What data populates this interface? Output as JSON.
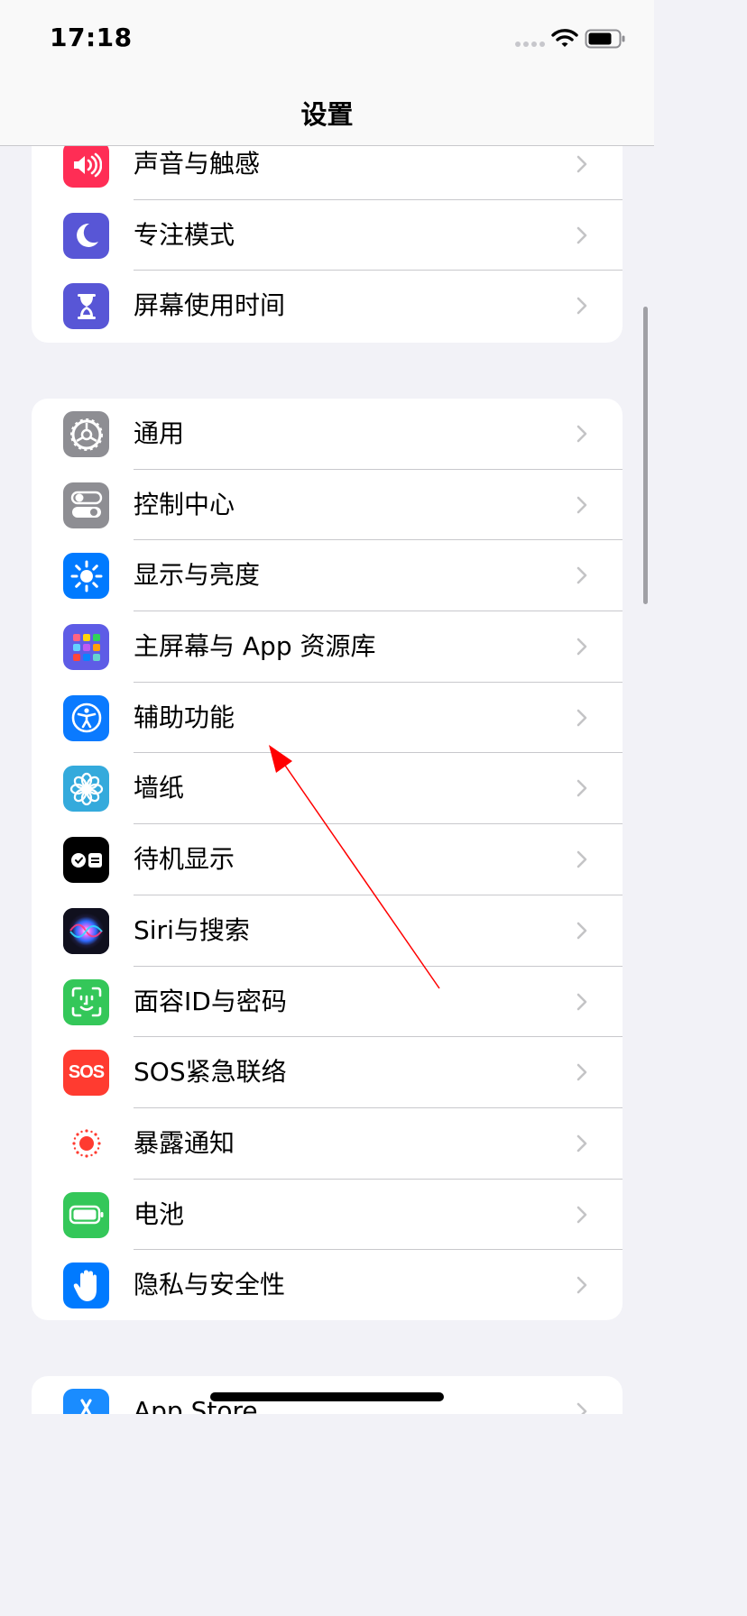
{
  "status_bar": {
    "time": "17:18"
  },
  "nav": {
    "title": "设置"
  },
  "group1": [
    {
      "label": "声音与触感",
      "icon": "speaker-icon",
      "color": "#ff2d55"
    },
    {
      "label": "专注模式",
      "icon": "moon-icon",
      "color": "#5856d6"
    },
    {
      "label": "屏幕使用时间",
      "icon": "hourglass-icon",
      "color": "#5856d6"
    }
  ],
  "group2": [
    {
      "label": "通用",
      "icon": "gear-icon",
      "color": "#8e8e93"
    },
    {
      "label": "控制中心",
      "icon": "toggles-icon",
      "color": "#8e8e93"
    },
    {
      "label": "显示与亮度",
      "icon": "sun-icon",
      "color": "#007aff"
    },
    {
      "label": "主屏幕与 App 资源库",
      "icon": "app-grid-icon",
      "color": "#5e5ce6"
    },
    {
      "label": "辅助功能",
      "icon": "accessibility-icon",
      "color": "#0a7aff"
    },
    {
      "label": "墙纸",
      "icon": "flower-icon",
      "color": "#34aadc"
    },
    {
      "label": "待机显示",
      "icon": "standby-icon",
      "color": "#000000"
    },
    {
      "label": "Siri与搜索",
      "icon": "siri-icon",
      "color": "#1c1c3a"
    },
    {
      "label": "面容ID与密码",
      "icon": "faceid-icon",
      "color": "#34c759"
    },
    {
      "label": "SOS紧急联络",
      "icon": "sos-icon",
      "color": "#ff3b30"
    },
    {
      "label": "暴露通知",
      "icon": "exposure-icon",
      "color": "#ffffff"
    },
    {
      "label": "电池",
      "icon": "battery-icon",
      "color": "#34c759"
    },
    {
      "label": "隐私与安全性",
      "icon": "hand-icon",
      "color": "#007aff"
    }
  ],
  "group3": [
    {
      "label": "App Store",
      "icon": "app-store-icon",
      "color": "#1a8cff"
    }
  ],
  "sos_icon_text": "SOS"
}
